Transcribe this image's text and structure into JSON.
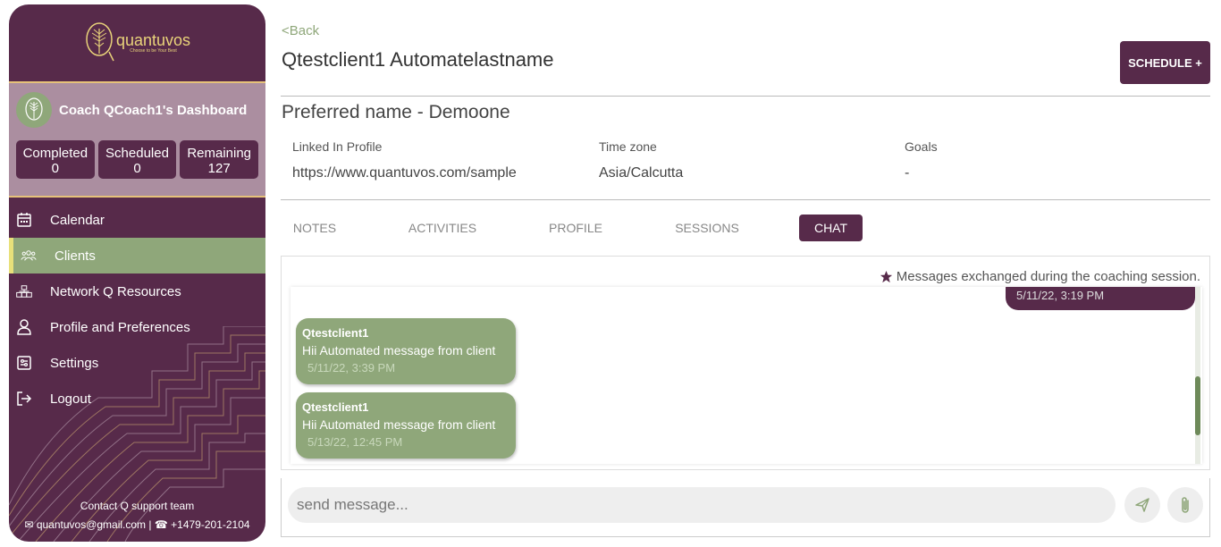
{
  "brand": {
    "name": "quantuvos",
    "tagline": "Choose to be Your Best"
  },
  "dashboard": {
    "title": "Coach QCoach1's Dashboard",
    "stats": [
      {
        "label": "Completed",
        "value": "0"
      },
      {
        "label": "Scheduled",
        "value": "0"
      },
      {
        "label": "Remaining",
        "value": "127"
      }
    ]
  },
  "nav": [
    {
      "label": "Calendar",
      "icon": "calendar-icon",
      "active": false
    },
    {
      "label": "Clients",
      "icon": "users-icon",
      "active": true
    },
    {
      "label": "Network Q Resources",
      "icon": "network-icon",
      "active": false
    },
    {
      "label": "Profile and Preferences",
      "icon": "user-icon",
      "active": false
    },
    {
      "label": "Settings",
      "icon": "settings-icon",
      "active": false
    },
    {
      "label": "Logout",
      "icon": "logout-icon",
      "active": false
    }
  ],
  "support": {
    "title": "Contact Q support team",
    "email": "quantuvos@gmail.com",
    "phone": "+1479-201-2104"
  },
  "header": {
    "back_label": "<Back",
    "client_name": "Qtestclient1 Automatelastname",
    "schedule_label": "SCHEDULE +"
  },
  "preferred": "Preferred name  - Demoone",
  "info": [
    {
      "label": "Linked In Profile",
      "value": "https://www.quantuvos.com/sample"
    },
    {
      "label": "Time zone",
      "value": "Asia/Calcutta"
    },
    {
      "label": "Goals",
      "value": "-"
    }
  ],
  "tabs": [
    {
      "label": "NOTES",
      "active": false
    },
    {
      "label": "ACTIVITIES",
      "active": false
    },
    {
      "label": "PROFILE",
      "active": false
    },
    {
      "label": "SESSIONS",
      "active": false
    },
    {
      "label": "CHAT",
      "active": true
    }
  ],
  "chat": {
    "note": "Messages exchanged during the coaching session.",
    "outgoing_time": "5/11/22, 3:19 PM",
    "messages": [
      {
        "from": "Qtestclient1",
        "text": "Hii Automated message from client",
        "time": "5/11/22, 3:39 PM"
      },
      {
        "from": "Qtestclient1",
        "text": "Hii Automated message from client",
        "time": "5/13/22, 12:45 PM"
      }
    ],
    "input_placeholder": "send message..."
  },
  "colors": {
    "primary": "#572a4a",
    "accent": "#8fa77a",
    "gold": "#e6c27a"
  }
}
